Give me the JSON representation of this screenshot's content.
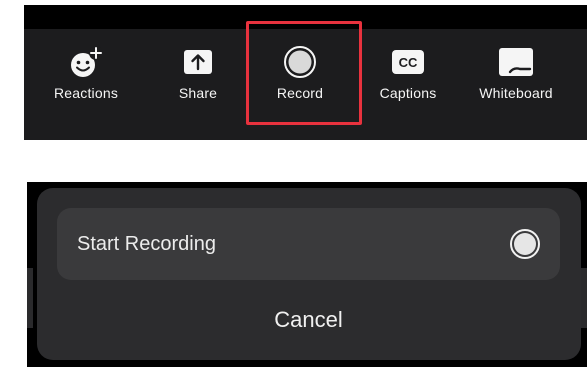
{
  "toolbar": {
    "items": [
      {
        "label": "Reactions",
        "icon": "add-reaction-icon"
      },
      {
        "label": "Share",
        "icon": "share-upload-icon"
      },
      {
        "label": "Record",
        "icon": "record-icon"
      },
      {
        "label": "Captions",
        "icon": "closed-captions-icon"
      },
      {
        "label": "Whiteboard",
        "icon": "whiteboard-icon"
      }
    ],
    "captions_badge": "CC",
    "highlight_color": "#e8323e"
  },
  "sheet": {
    "option_label": "Start Recording",
    "option_icon": "record-radio-icon",
    "cancel_label": "Cancel"
  },
  "colors": {
    "toolbar_bg": "#1c1c1e",
    "sheet_bg": "#2c2c2e",
    "row_bg": "#3a3a3c"
  }
}
